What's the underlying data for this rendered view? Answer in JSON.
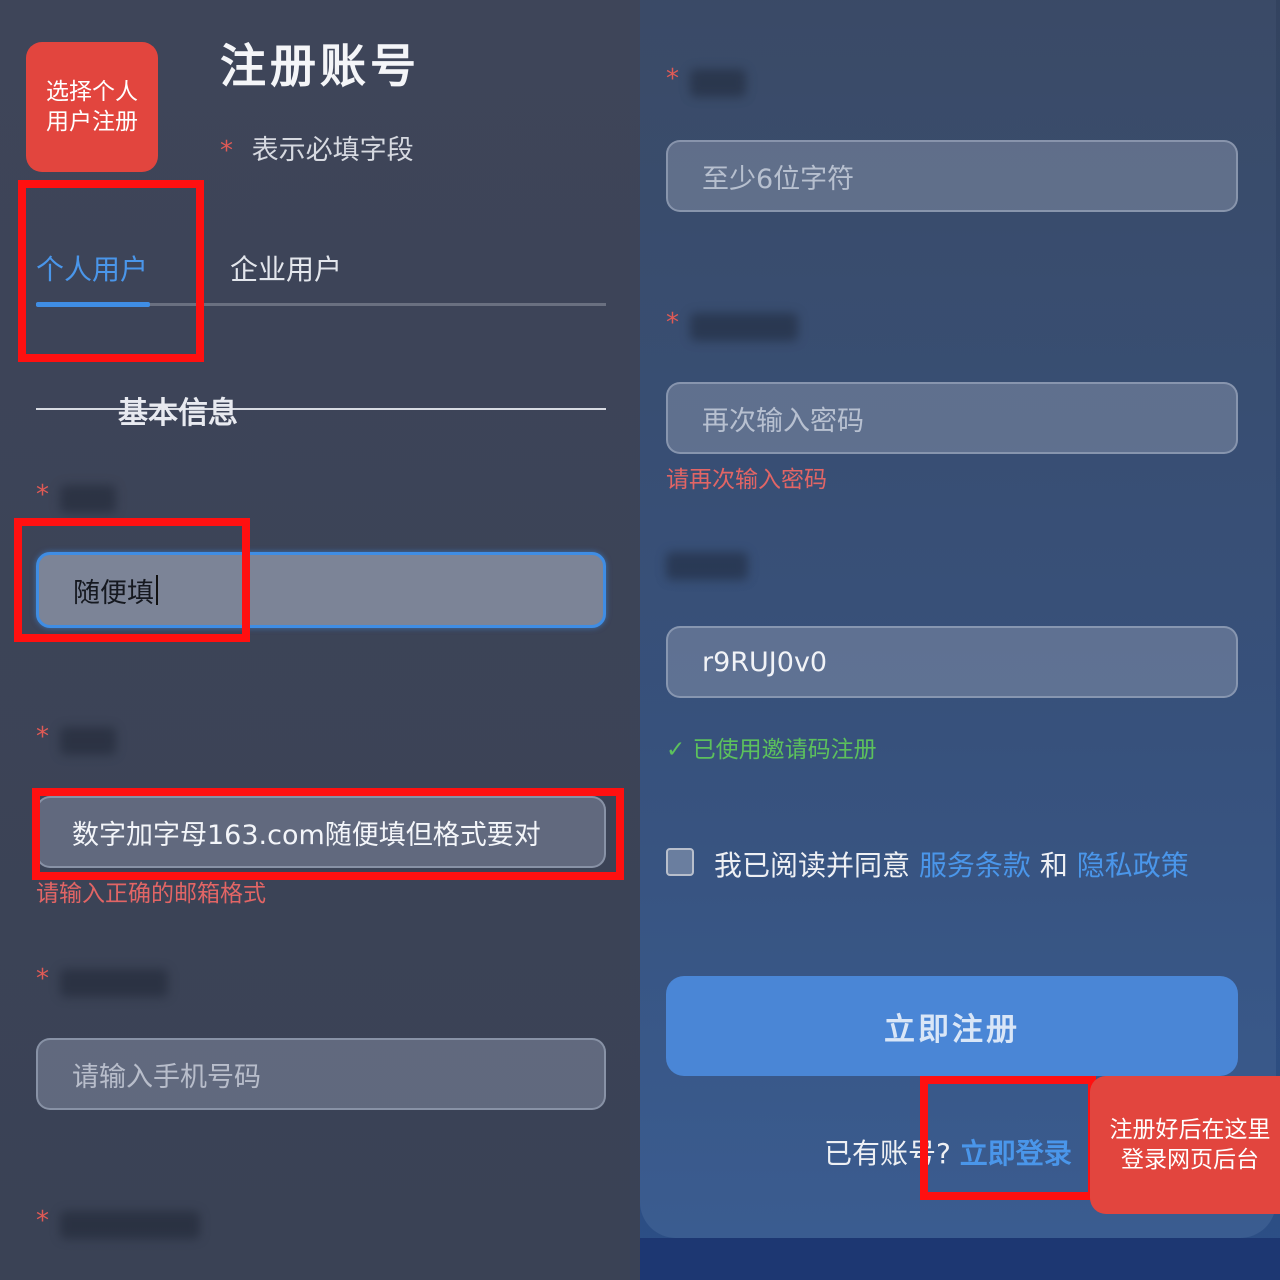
{
  "header": {
    "title": "注册账号",
    "required_star": "*",
    "required_note": "表示必填字段",
    "callout": [
      "选择个人",
      "用户注册"
    ]
  },
  "tabs": [
    {
      "label": "个人用户",
      "active": true
    },
    {
      "label": "企业用户",
      "active": false
    }
  ],
  "section": {
    "title": "基本信息"
  },
  "form_left": {
    "username": {
      "value": "随便填"
    },
    "email": {
      "value": "数字加字母163.com随便填但格式要对",
      "error": "请输入正确的邮箱格式"
    },
    "phone": {
      "placeholder": "请输入手机号码"
    }
  },
  "form_right": {
    "password": {
      "placeholder": "至少6位字符"
    },
    "confirm_password": {
      "placeholder": "再次输入密码",
      "error": "请再次输入密码"
    },
    "invite": {
      "value": "r9RUJ0v0",
      "success": "✓ 已使用邀请码注册"
    },
    "agree": {
      "prefix": "我已阅读并同意",
      "terms": "服务条款",
      "and": "和",
      "privacy": "隐私政策",
      "checked": false
    },
    "submit_label": "立即注册",
    "login_prompt": "已有账号?",
    "login_link": "立即登录",
    "callout": [
      "注册好后在这里",
      "登录网页后台"
    ]
  },
  "colors": {
    "accent": "#4a90e2",
    "error": "#e26565",
    "success": "#5cc15c",
    "annotation_red": "#ff1010",
    "callout_red": "#e2453e"
  }
}
